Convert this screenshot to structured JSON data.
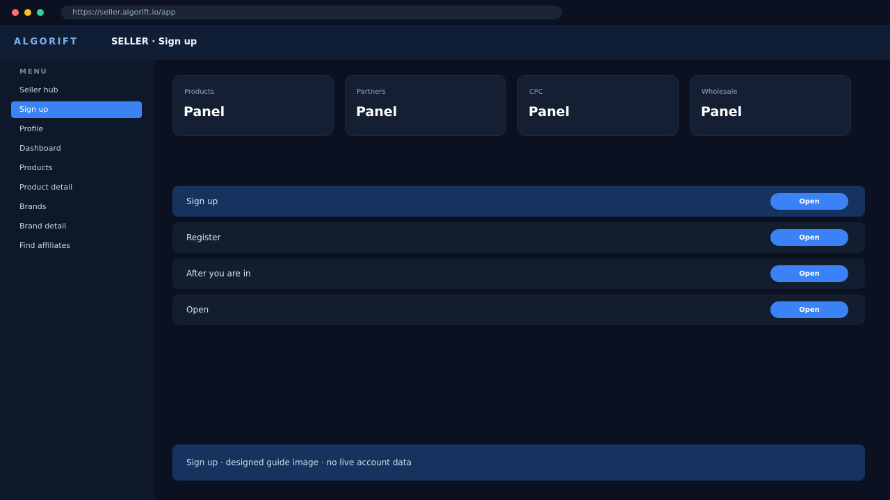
{
  "browser": {
    "url": "https://seller.algorift.io/app"
  },
  "appbar": {
    "brand": "ALGORIFT",
    "title": "SELLER · Sign up"
  },
  "sidebar": {
    "heading": "MENU",
    "items": [
      {
        "label": "Seller hub"
      },
      {
        "label": "Sign up",
        "active": true
      },
      {
        "label": "Profile"
      },
      {
        "label": "Dashboard"
      },
      {
        "label": "Products"
      },
      {
        "label": "Product detail"
      },
      {
        "label": "Brands"
      },
      {
        "label": "Brand detail"
      },
      {
        "label": "Find affiliates"
      }
    ]
  },
  "cards": [
    {
      "label": "Products",
      "value": "Panel"
    },
    {
      "label": "Partners",
      "value": "Panel"
    },
    {
      "label": "CPC",
      "value": "Panel"
    },
    {
      "label": "Wholesale",
      "value": "Panel"
    }
  ],
  "rows": [
    {
      "label": "Sign up",
      "button": "Open",
      "active": true
    },
    {
      "label": "Register",
      "button": "Open"
    },
    {
      "label": "After you are in",
      "button": "Open"
    },
    {
      "label": "Open",
      "button": "Open"
    }
  ],
  "footer": {
    "note": "Sign up · designed guide image · no live account data"
  },
  "colors": {
    "accent": "#3b82f6",
    "background": "#0b1120",
    "appbar": "#0f1d35",
    "sidebar": "#0e182b",
    "card": "#141f33",
    "row_active": "#15335e"
  }
}
